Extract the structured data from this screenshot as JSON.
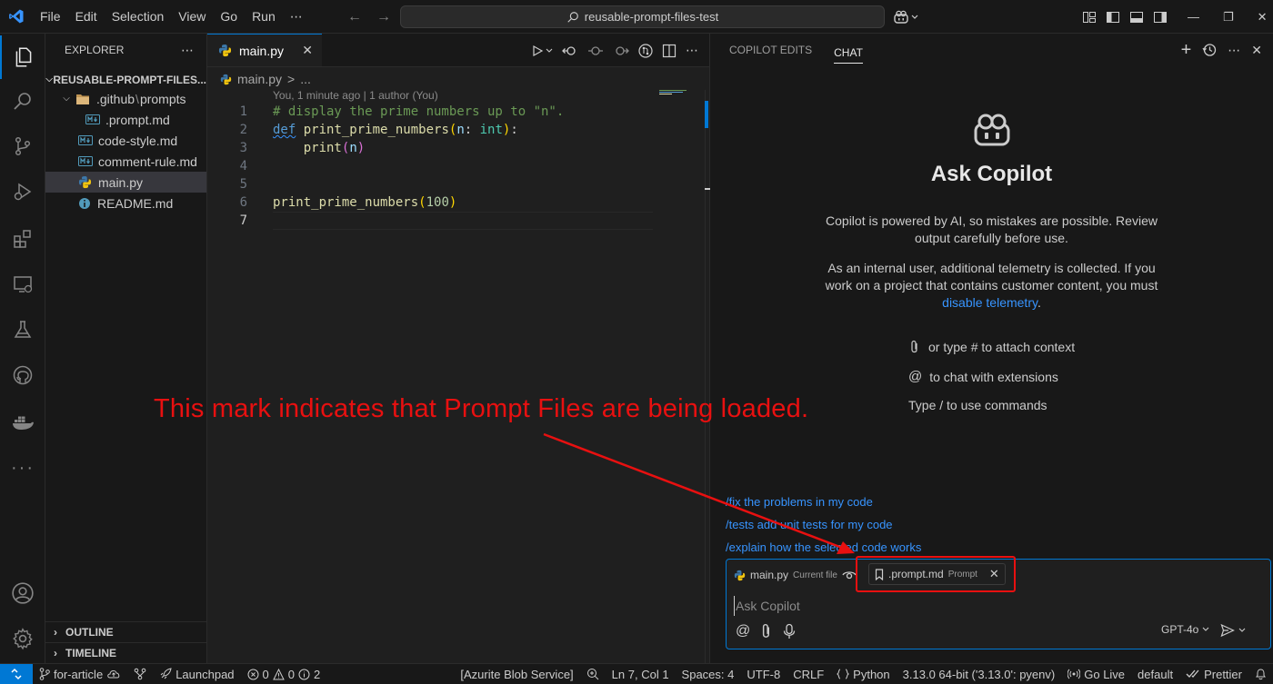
{
  "menu": {
    "items": [
      "File",
      "Edit",
      "Selection",
      "View",
      "Go",
      "Run"
    ],
    "more": "⋯"
  },
  "command_center": {
    "text": "reusable-prompt-files-test"
  },
  "sidebar": {
    "title": "EXPLORER",
    "more": "⋯",
    "root": "REUSABLE-PROMPT-FILES...",
    "folder_part1": ".github",
    "folder_sep": "\\",
    "folder_part2": "prompts",
    "files": [
      {
        "name": ".prompt.md",
        "icon": "markdown-icon"
      },
      {
        "name": "code-style.md",
        "icon": "markdown-icon"
      },
      {
        "name": "comment-rule.md",
        "icon": "markdown-icon"
      },
      {
        "name": "main.py",
        "icon": "python-icon",
        "selected": true
      },
      {
        "name": "README.md",
        "icon": "markdown-icon"
      }
    ],
    "outline": "OUTLINE",
    "timeline": "TIMELINE"
  },
  "editor": {
    "tab_label": "main.py",
    "breadcrumb_file": "main.py",
    "breadcrumb_sep": ">",
    "breadcrumb_more": "...",
    "blame": "You, 1 minute ago | 1 author (You)",
    "lines": [
      {
        "no": "1",
        "code": "# display the prime numbers up to \"n\"."
      },
      {
        "no": "2",
        "code": "def print_prime_numbers(n: int):"
      },
      {
        "no": "3",
        "code": "    print(n)"
      },
      {
        "no": "4",
        "code": ""
      },
      {
        "no": "5",
        "code": ""
      },
      {
        "no": "6",
        "code": "print_prime_numbers(100)"
      },
      {
        "no": "7",
        "code": ""
      }
    ],
    "tokens": {
      "comment": "# display the prime numbers up to \"n\".",
      "def": "def",
      "fn": "print_prime_numbers",
      "paren_open": "(",
      "param": "n",
      "colon": ": ",
      "type": "int",
      "paren_close": ")",
      "colon_end": ":",
      "print": "print",
      "print_arg": "n",
      "call_fn": "print_prime_numbers",
      "call_arg": "100"
    }
  },
  "chat": {
    "tab_edits": "COPILOT EDITS",
    "tab_chat": "CHAT",
    "title": "Ask Copilot",
    "para1": "Copilot is powered by AI, so mistakes are possible. Review output carefully before use.",
    "para2_text": "As an internal user, additional telemetry is collected. If you work on a project that contains customer content, you must",
    "para2_link": "disable telemetry",
    "para2_end": ".",
    "hint_attach": "or type # to attach context",
    "hint_extensions_symbol": "@",
    "hint_extensions": "to chat with extensions",
    "hint_commands": "Type / to use commands",
    "suggestions": [
      "/fix the problems in my code",
      "/tests add unit tests for my code",
      "/explain how the selected code works"
    ],
    "chip1_name": "main.py",
    "chip1_sub": "Current file",
    "chip2_name": ".prompt.md",
    "chip2_sub": "Prompt",
    "input_placeholder": "Ask Copilot",
    "model": "GPT-4o"
  },
  "annotation": {
    "text": "This mark indicates that Prompt Files are being loaded.",
    "color": "#e81010"
  },
  "statusbar": {
    "branch": "for-article",
    "launchpad": "Launchpad",
    "errors": "0",
    "warnings": "0",
    "info": "2",
    "azurite": "[Azurite Blob Service]",
    "position": "Ln 7, Col 1",
    "spaces": "Spaces: 4",
    "encoding": "UTF-8",
    "eol": "CRLF",
    "language": "Python",
    "interpreter": "3.13.0 64-bit ('3.13.0': pyenv)",
    "golive": "Go Live",
    "profile": "default",
    "prettier": "Prettier"
  },
  "colors": {
    "accent": "#0078d4",
    "link": "#3794ff",
    "annotation": "#e81010"
  }
}
